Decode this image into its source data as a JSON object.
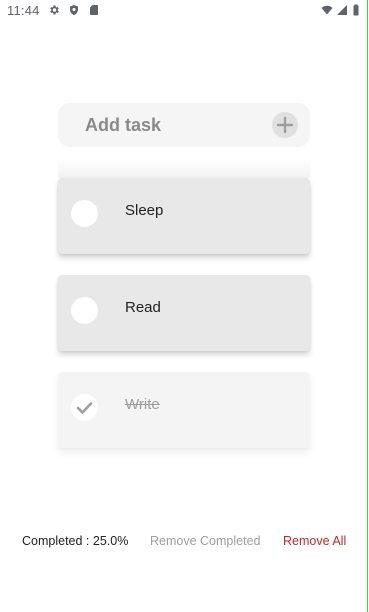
{
  "status_bar": {
    "time": "11:44",
    "icons": [
      "settings-gear-icon",
      "shield-icon",
      "sim-card-icon",
      "wifi-icon",
      "signal-icon",
      "battery-icon"
    ]
  },
  "add_task": {
    "placeholder": "Add task",
    "add_icon": "plus-icon"
  },
  "tasks": [
    {
      "label": "Sleep",
      "completed": false
    },
    {
      "label": "Read",
      "completed": false
    },
    {
      "label": "Write",
      "completed": true
    }
  ],
  "footer": {
    "completed_label": "Completed : 25.0%",
    "remove_completed_label": "Remove Completed",
    "remove_all_label": "Remove All"
  },
  "colors": {
    "remove_all": "#c62828",
    "edge_line": "#39d639"
  }
}
